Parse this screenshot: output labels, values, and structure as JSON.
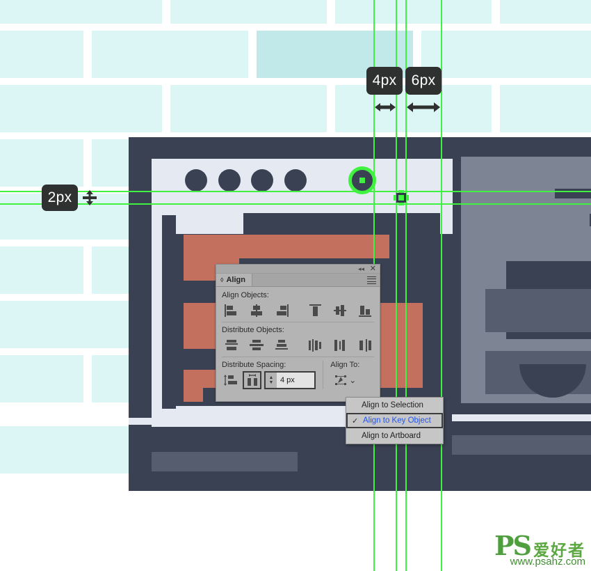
{
  "badges": [
    {
      "name": "2px",
      "label": "2px",
      "arrow": "horizontal-double-arrow"
    },
    {
      "name": "4px",
      "label": "4px",
      "arrow": "horizontal-double-arrow"
    },
    {
      "name": "6px",
      "label": "6px",
      "arrow": "horizontal-double-arrow"
    }
  ],
  "panel": {
    "tab_label": "Align",
    "collapse_glyph": "◂◂",
    "close_glyph": "✕",
    "sections": {
      "align_objects_label": "Align Objects:",
      "distribute_objects_label": "Distribute Objects:",
      "distribute_spacing_label": "Distribute Spacing:",
      "align_to_label": "Align To:"
    },
    "align_objects_buttons": [
      "horizontal-align-left-icon",
      "horizontal-align-center-icon",
      "horizontal-align-right-icon",
      "vertical-align-top-icon",
      "vertical-align-center-icon",
      "vertical-align-bottom-icon"
    ],
    "distribute_objects_buttons": [
      "vertical-distribute-top-icon",
      "vertical-distribute-center-icon",
      "vertical-distribute-bottom-icon",
      "horizontal-distribute-left-icon",
      "horizontal-distribute-center-icon",
      "horizontal-distribute-right-icon"
    ],
    "spacing_value": "4 px",
    "spacing_buttons": {
      "vertical": "vertical-distribute-spacing-icon",
      "horizontal": "horizontal-distribute-spacing-icon",
      "horizontal_selected": true
    },
    "align_to_icon": "align-to-key-object-icon",
    "align_to_chevron": "⌄"
  },
  "dropdown": {
    "items": [
      {
        "label": "Align to Selection",
        "checked": false
      },
      {
        "label": "Align to Key Object",
        "checked": true
      },
      {
        "label": "Align to Artboard",
        "checked": false
      }
    ],
    "check_glyph": "✓",
    "highlight_color": "#2255ee"
  },
  "watermark": {
    "brand": "PS",
    "chinese": "爱好者",
    "url": "www.psahz.com"
  },
  "colors": {
    "guide_green": "#3ff23f",
    "brick_fill": "#dcf5f5",
    "brick_highlight": "#c2e9ea",
    "illustration_navy": "#3a4152",
    "illustration_lavender": "#e5e9f2",
    "illustration_salmon": "#c4705e",
    "illustration_grey_light": "#7d8494",
    "illustration_grey_dark": "#555d6e",
    "badge_background": "#2f3030",
    "panel_background": "#b4b4b4"
  }
}
